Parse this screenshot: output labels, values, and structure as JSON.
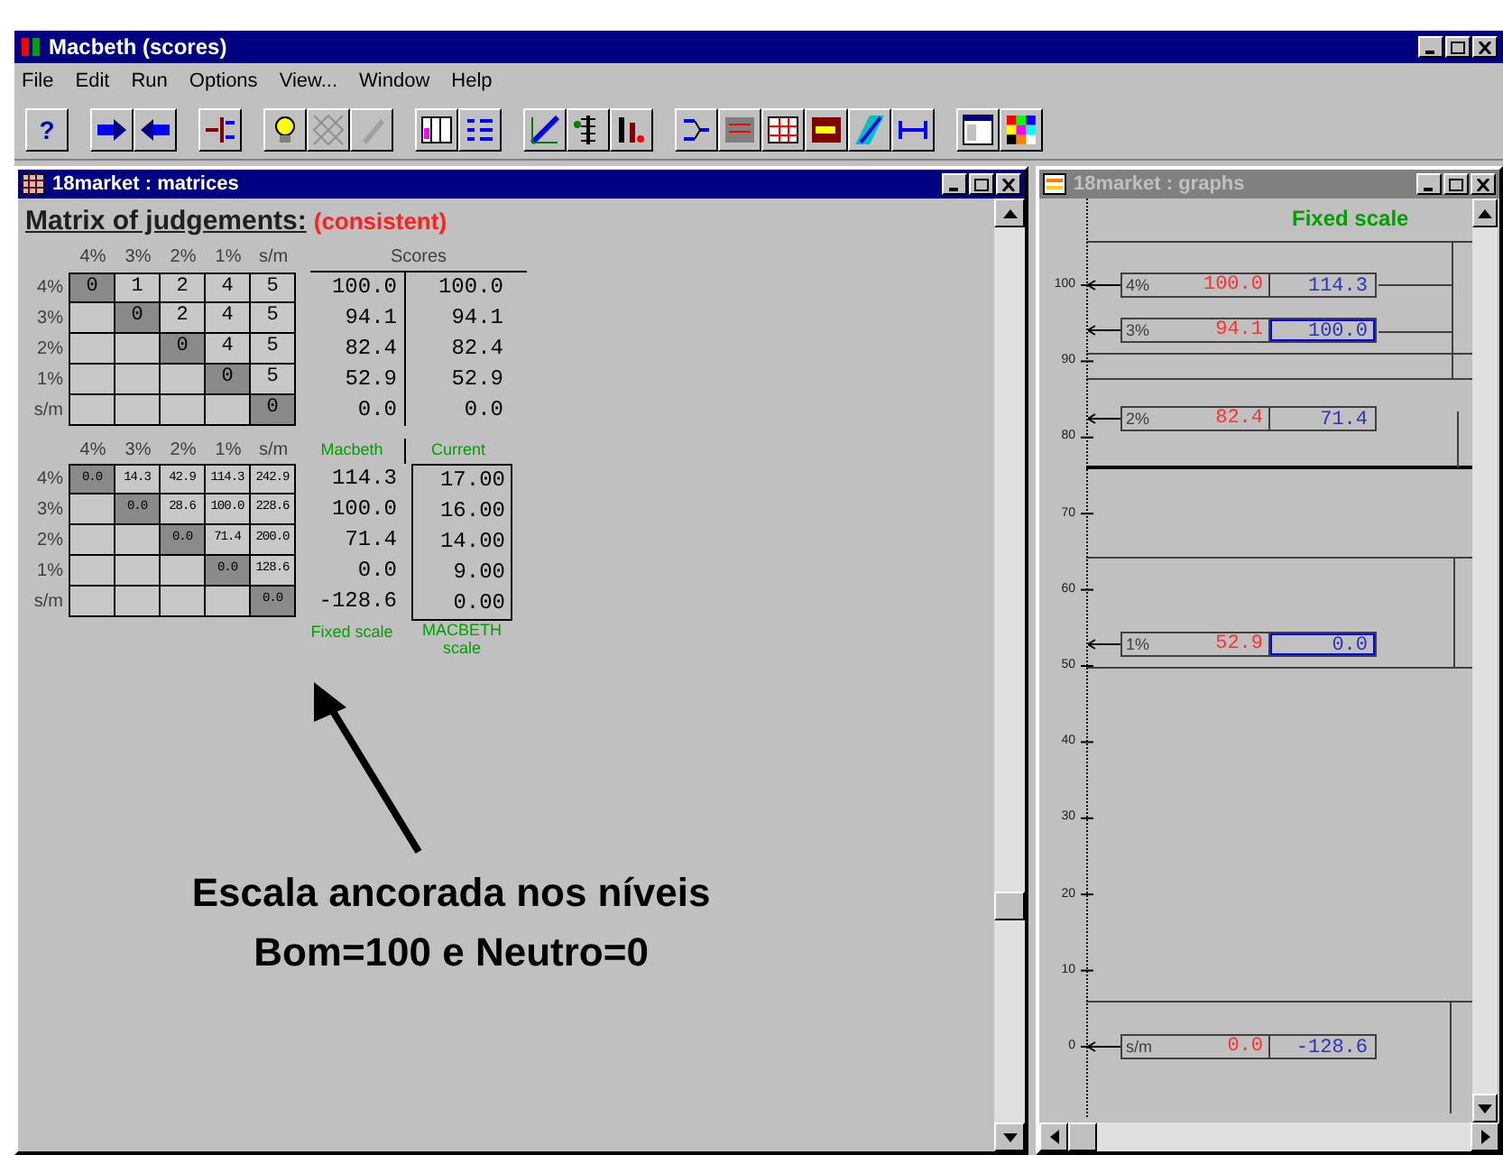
{
  "window": {
    "title": "Macbeth (scores)"
  },
  "menu": [
    "File",
    "Edit",
    "Run",
    "Options",
    "View...",
    "Window",
    "Help"
  ],
  "toolbar": {
    "help_label": "?"
  },
  "matrices_window": {
    "title": "18market : matrices",
    "heading": "Matrix of judgements:",
    "status": "(consistent)",
    "judgement_matrix": {
      "columns": [
        "4%",
        "3%",
        "2%",
        "1%",
        "s/m"
      ],
      "rows": [
        {
          "label": "4%",
          "cells": [
            "0",
            "1",
            "2",
            "4",
            "5"
          ]
        },
        {
          "label": "3%",
          "cells": [
            "",
            "0",
            "2",
            "4",
            "5"
          ]
        },
        {
          "label": "2%",
          "cells": [
            "",
            "",
            "0",
            "4",
            "5"
          ]
        },
        {
          "label": "1%",
          "cells": [
            "",
            "",
            "",
            "0",
            "5"
          ]
        },
        {
          "label": "s/m",
          "cells": [
            "",
            "",
            "",
            "",
            "0"
          ]
        }
      ]
    },
    "scores_heading": "Scores",
    "scores": [
      {
        "macbeth": "100.0",
        "current": "100.0"
      },
      {
        "macbeth": "94.1",
        "current": "94.1"
      },
      {
        "macbeth": "82.4",
        "current": "82.4"
      },
      {
        "macbeth": "52.9",
        "current": "52.9"
      },
      {
        "macbeth": "0.0",
        "current": "0.0"
      }
    ],
    "score_labels": [
      "Macbeth",
      "Current"
    ],
    "difference_matrix": {
      "columns": [
        "4%",
        "3%",
        "2%",
        "1%",
        "s/m"
      ],
      "rows": [
        {
          "label": "4%",
          "cells": [
            "0.0",
            "14.3",
            "42.9",
            "114.3",
            "242.9"
          ]
        },
        {
          "label": "3%",
          "cells": [
            "",
            "0.0",
            "28.6",
            "100.0",
            "228.6"
          ]
        },
        {
          "label": "2%",
          "cells": [
            "",
            "",
            "0.0",
            "71.4",
            "200.0"
          ]
        },
        {
          "label": "1%",
          "cells": [
            "",
            "",
            "",
            "0.0",
            "128.6"
          ]
        },
        {
          "label": "s/m",
          "cells": [
            "",
            "",
            "",
            "",
            "0.0"
          ]
        }
      ]
    },
    "scales": [
      {
        "fixed": "114.3",
        "macbeth": "17.00"
      },
      {
        "fixed": "100.0",
        "macbeth": "16.00"
      },
      {
        "fixed": "71.4",
        "macbeth": "14.00"
      },
      {
        "fixed": "0.0",
        "macbeth": "9.00"
      },
      {
        "fixed": "-128.6",
        "macbeth": "0.00"
      }
    ],
    "scale_labels": [
      "Fixed scale",
      "MACBETH scale"
    ]
  },
  "annotation": {
    "lines": [
      "Escala ancorada nos níveis",
      "Bom=100 e Neutro=0"
    ]
  },
  "graphs_window": {
    "title": "18market : graphs",
    "scale_title": "Fixed scale",
    "axis_ticks": [
      "100",
      "90",
      "80",
      "70",
      "60",
      "50",
      "40",
      "30",
      "20",
      "10",
      "0"
    ],
    "levels": [
      {
        "label": "4%",
        "score": "100.0",
        "macbeth": "114.3",
        "highlighted": false
      },
      {
        "label": "3%",
        "score": "94.1",
        "macbeth": "100.0",
        "highlighted": true
      },
      {
        "label": "2%",
        "score": "82.4",
        "macbeth": "71.4",
        "highlighted": false
      },
      {
        "label": "1%",
        "score": "52.9",
        "macbeth": "0.0",
        "highlighted": true
      },
      {
        "label": "s/m",
        "score": "0.0",
        "macbeth": "-128.6",
        "highlighted": false
      }
    ]
  }
}
